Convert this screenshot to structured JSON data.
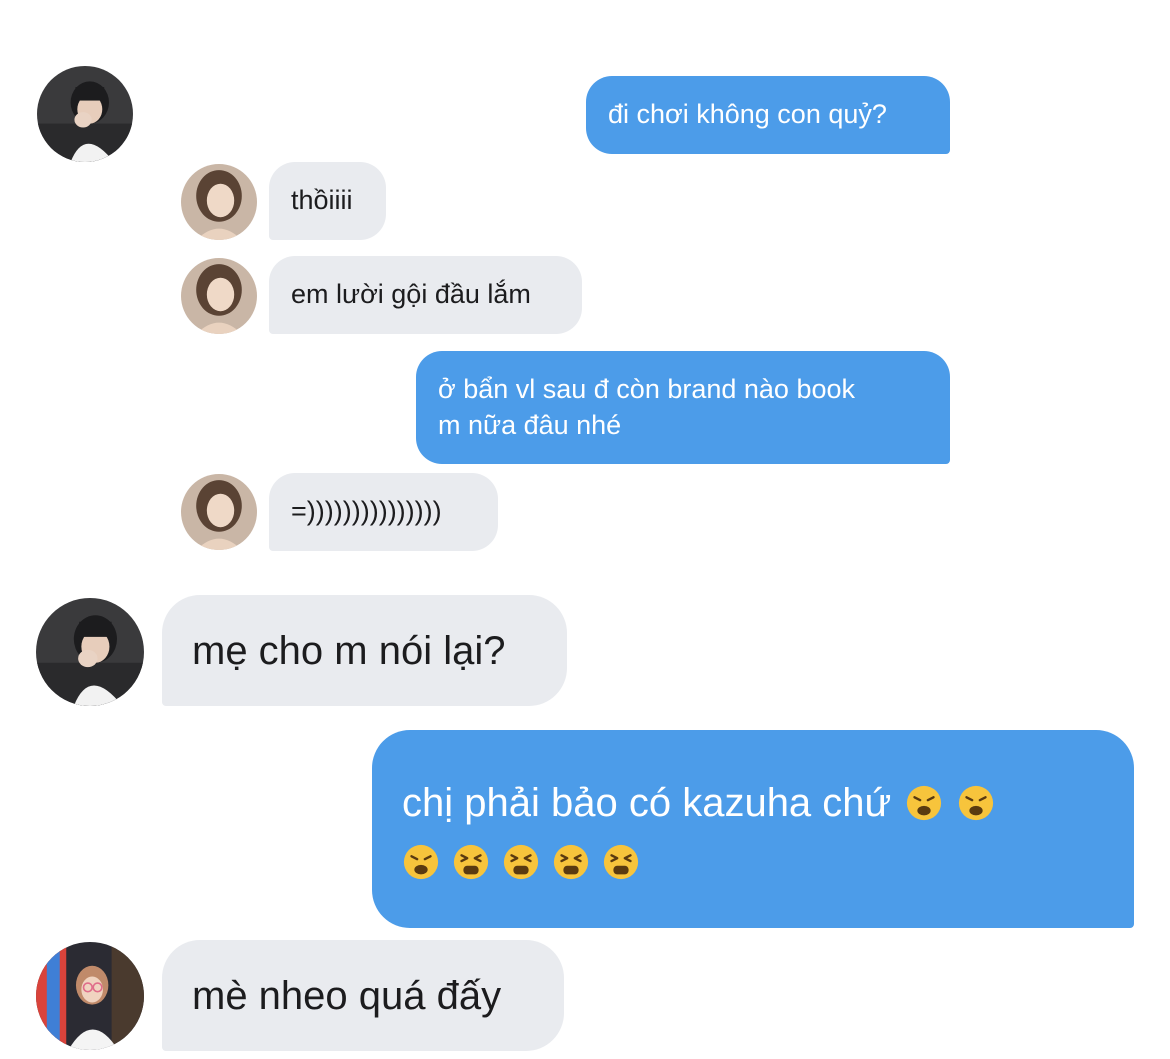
{
  "messages": [
    {
      "id": "m1",
      "text": "đi chơi không con quỷ?",
      "dir": "out"
    },
    {
      "id": "m2",
      "text": "thồiiii",
      "dir": "in"
    },
    {
      "id": "m3",
      "text": "em lười gội đầu lắm",
      "dir": "in"
    },
    {
      "id": "m4",
      "line1": "ở bẩn vl sau đ còn brand nào book",
      "line2": "m nữa đâu nhé",
      "dir": "out"
    },
    {
      "id": "m5",
      "text": "=)))))))))))))))",
      "dir": "in"
    },
    {
      "id": "m6",
      "text": "mẹ cho m nói lại?",
      "dir": "in"
    },
    {
      "id": "m7",
      "line1": "chị phải bảo có kazuha chứ",
      "dir": "out",
      "emojis": [
        "weary-face",
        "weary-face",
        "weary-face",
        "tired-face",
        "tired-face",
        "tired-face",
        "tired-face"
      ]
    },
    {
      "id": "m8",
      "text": "mè nheo quá đấy",
      "dir": "in"
    }
  ],
  "colors": {
    "incoming_bubble": "#e9ebef",
    "outgoing_bubble": "#4c9ce9",
    "emoji": "#f7c43c"
  }
}
